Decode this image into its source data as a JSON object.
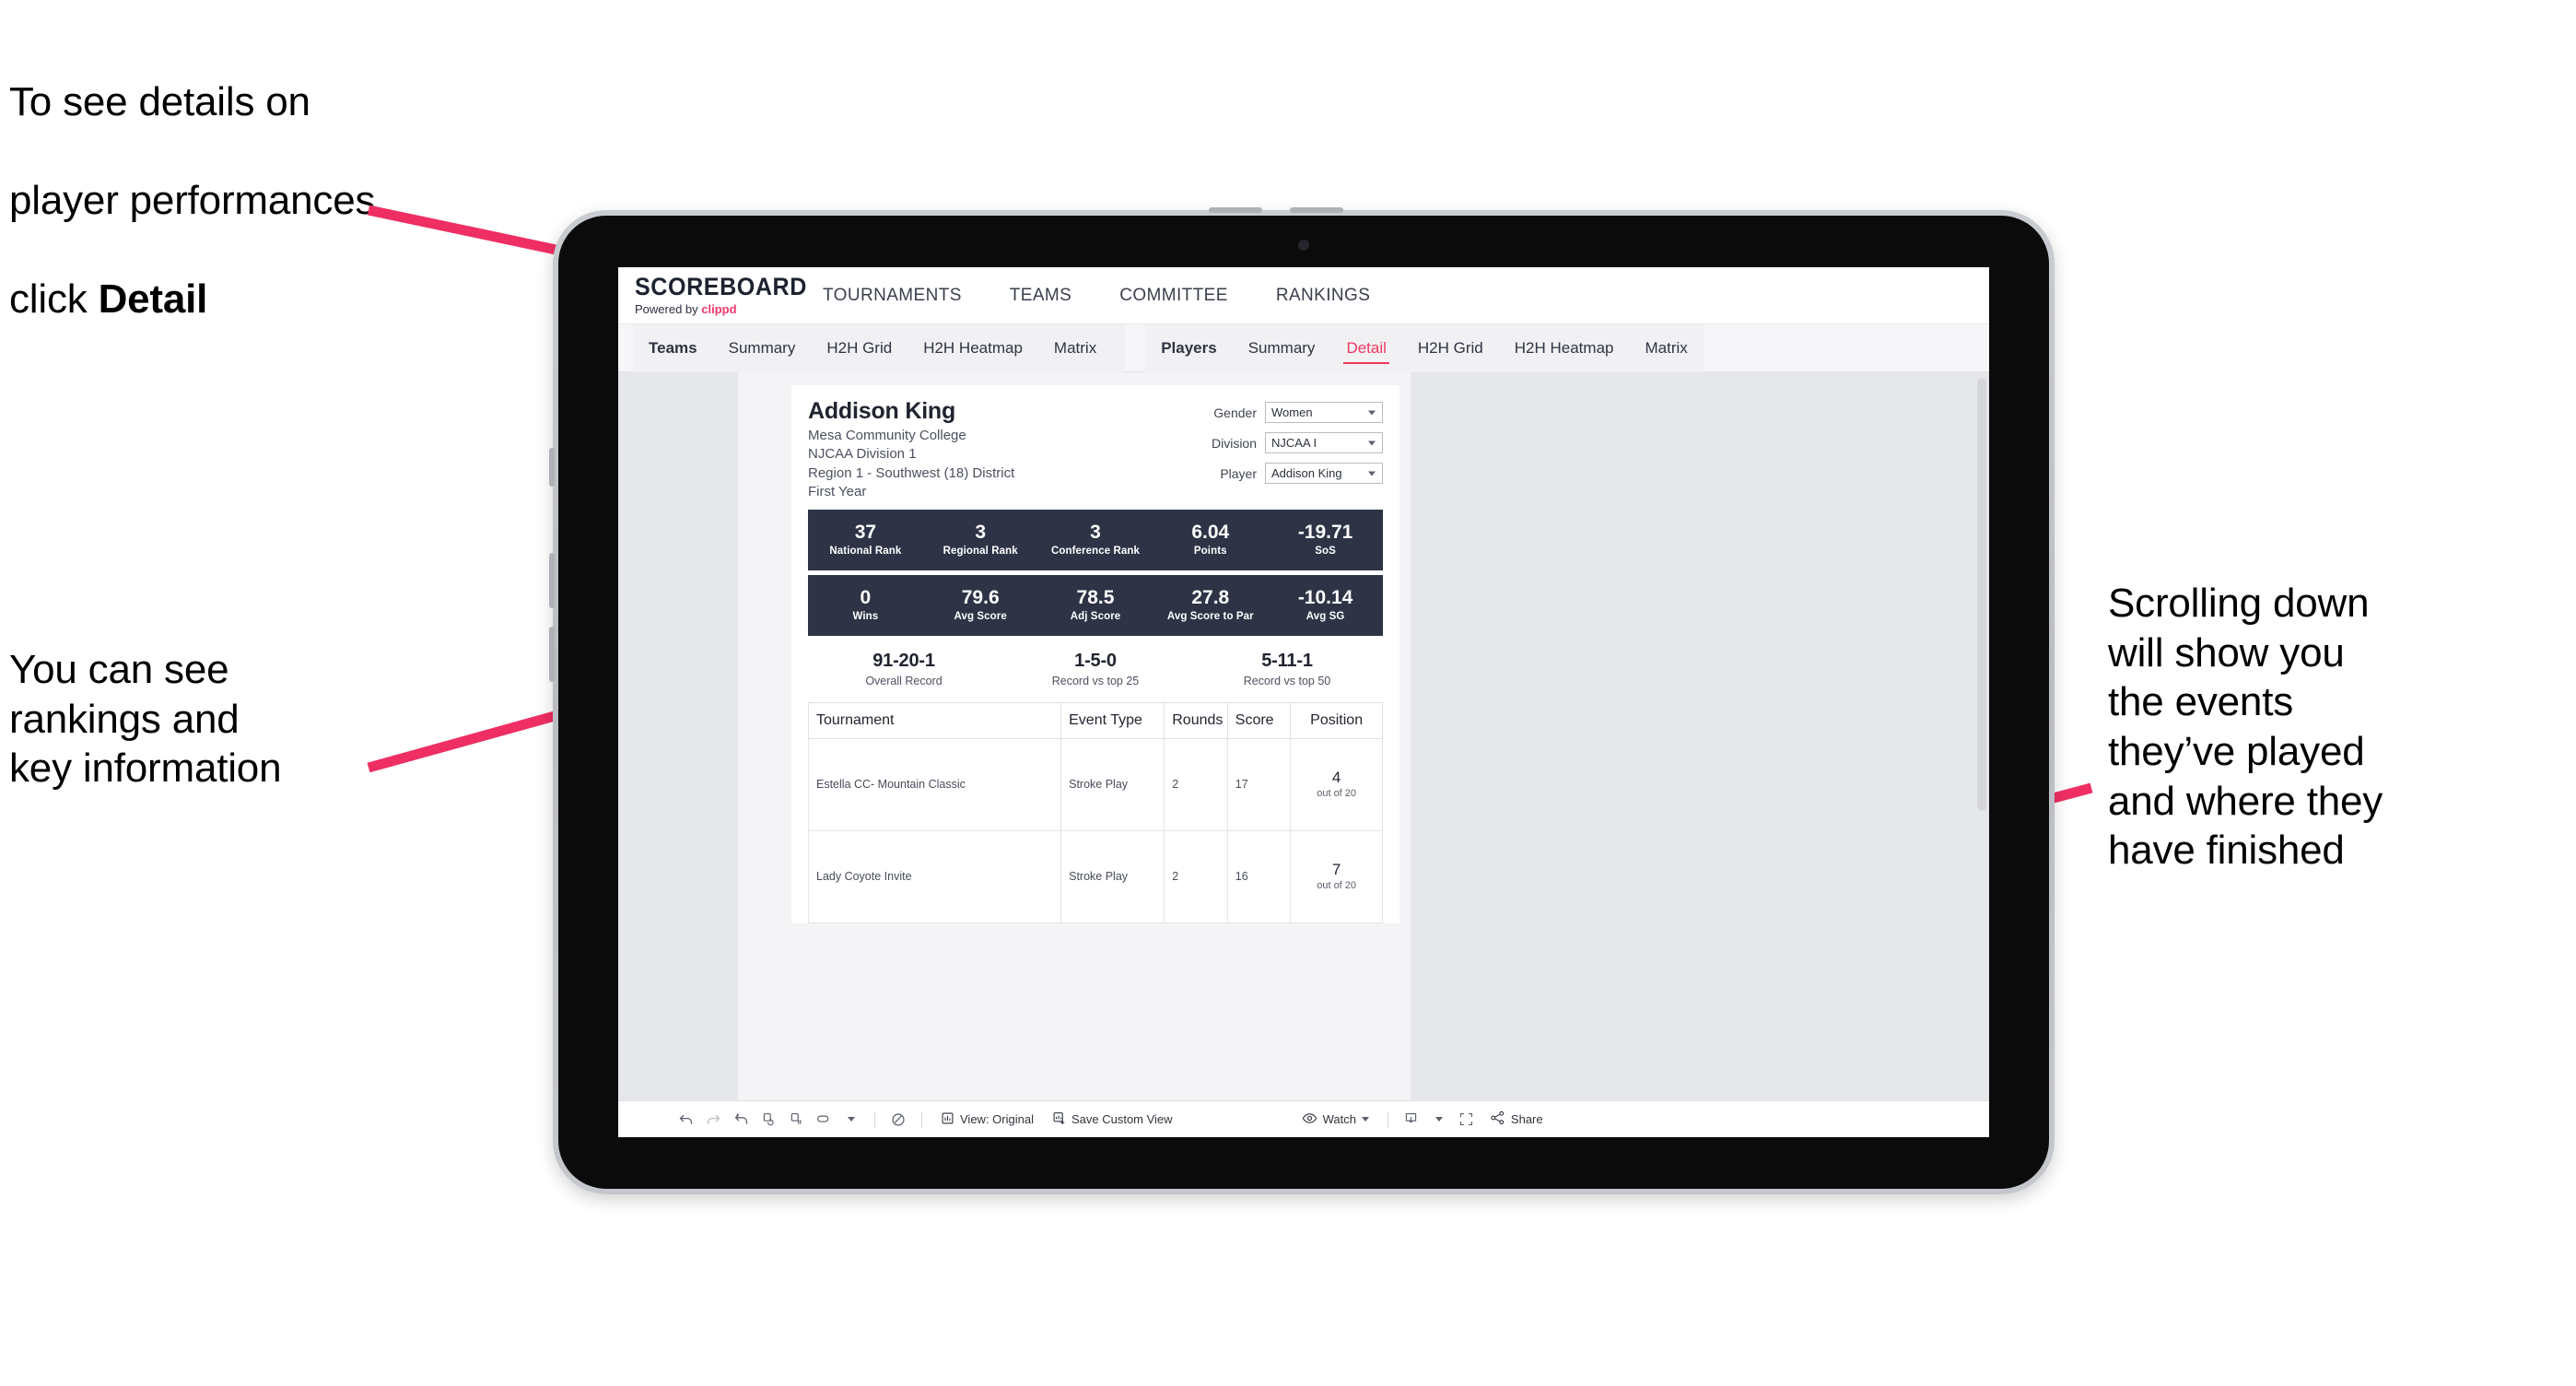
{
  "annotations": {
    "top_left": {
      "line1": "To see details on",
      "line2": "player performances",
      "line3_prefix": "click ",
      "line3_bold": "Detail"
    },
    "bottom_left": "You can see\nrankings and\nkey information",
    "right": "Scrolling down\nwill show you\nthe events\nthey’ve played\nand where they\nhave finished"
  },
  "colors": {
    "accent_pink": "#f0385f",
    "band_navy": "#2e3446",
    "screen_bg": "#e6e7ea"
  },
  "app": {
    "brand": {
      "title": "SCOREBOARD",
      "powered_prefix": "Powered by ",
      "powered_name": "clippd"
    },
    "nav": [
      {
        "label": "TOURNAMENTS"
      },
      {
        "label": "TEAMS"
      },
      {
        "label": "COMMITTEE"
      },
      {
        "label": "RANKINGS"
      }
    ],
    "tabs_teams": [
      {
        "label": "Teams",
        "active": false,
        "head": true
      },
      {
        "label": "Summary",
        "active": false
      },
      {
        "label": "H2H Grid",
        "active": false
      },
      {
        "label": "H2H Heatmap",
        "active": false
      },
      {
        "label": "Matrix",
        "active": false
      }
    ],
    "tabs_players": [
      {
        "label": "Players",
        "active": false,
        "head": true
      },
      {
        "label": "Summary",
        "active": false
      },
      {
        "label": "Detail",
        "active": true
      },
      {
        "label": "H2H Grid",
        "active": false
      },
      {
        "label": "H2H Heatmap",
        "active": false
      },
      {
        "label": "Matrix",
        "active": false
      }
    ]
  },
  "dashboard": {
    "player": {
      "name": "Addison King",
      "school": "Mesa Community College",
      "division": "NJCAA Division 1",
      "region": "Region 1 - Southwest (18) District",
      "year": "First Year"
    },
    "filters": [
      {
        "label": "Gender",
        "value": "Women"
      },
      {
        "label": "Division",
        "value": "NJCAA I"
      },
      {
        "label": "Player",
        "value": "Addison King"
      }
    ],
    "stats_row1": [
      {
        "value": "37",
        "label": "National Rank"
      },
      {
        "value": "3",
        "label": "Regional Rank"
      },
      {
        "value": "3",
        "label": "Conference Rank"
      },
      {
        "value": "6.04",
        "label": "Points"
      },
      {
        "value": "-19.71",
        "label": "SoS"
      }
    ],
    "stats_row2": [
      {
        "value": "0",
        "label": "Wins"
      },
      {
        "value": "79.6",
        "label": "Avg Score"
      },
      {
        "value": "78.5",
        "label": "Adj Score"
      },
      {
        "value": "27.8",
        "label": "Avg Score to Par"
      },
      {
        "value": "-10.14",
        "label": "Avg SG"
      }
    ],
    "records": [
      {
        "value": "91-20-1",
        "label": "Overall Record"
      },
      {
        "value": "1-5-0",
        "label": "Record vs top 25"
      },
      {
        "value": "5-11-1",
        "label": "Record vs top 50"
      }
    ],
    "events_table": {
      "columns": [
        "Tournament",
        "Event Type",
        "Rounds",
        "Score",
        "Position"
      ],
      "rows": [
        {
          "tournament": "Estella CC- Mountain Classic",
          "event_type": "Stroke Play",
          "rounds": "2",
          "score": "17",
          "position_num": "4",
          "position_out_of": "out of 20"
        },
        {
          "tournament": "Lady Coyote Invite",
          "event_type": "Stroke Play",
          "rounds": "2",
          "score": "16",
          "position_num": "7",
          "position_out_of": "out of 20"
        }
      ]
    }
  },
  "toolbar": {
    "view_label": "View: Original",
    "save_label": "Save Custom View",
    "watch_label": "Watch",
    "share_label": "Share"
  }
}
